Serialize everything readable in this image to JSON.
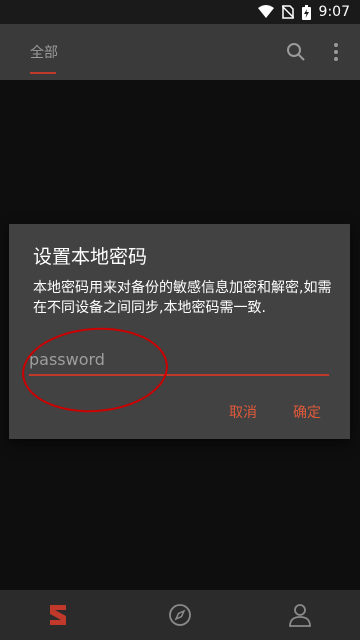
{
  "status": {
    "time": "9:07"
  },
  "appbar": {
    "tab_label": "全部",
    "search_icon": "search-icon",
    "more_icon": "more-vertical-icon"
  },
  "dialog": {
    "title": "设置本地密码",
    "message": "本地密码用来对备份的敏感信息加密和解密,如需在不同设备之间同步,本地密码需一致.",
    "input_placeholder": "password",
    "cancel_label": "取消",
    "ok_label": "确定"
  },
  "colors": {
    "accent": "#c0392b",
    "dialog_bg": "#424242",
    "annotation": "#cc0000"
  },
  "bottomnav": {
    "items": [
      "logo-icon",
      "compass-icon",
      "person-icon"
    ]
  }
}
